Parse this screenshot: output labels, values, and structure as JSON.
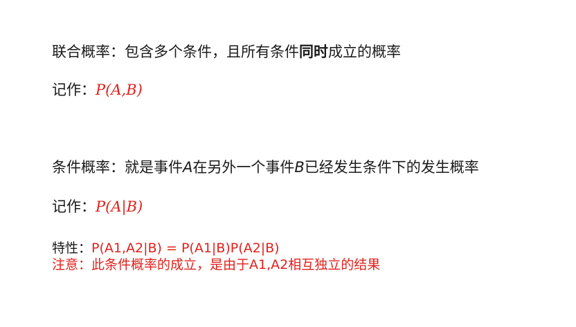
{
  "joint": {
    "title_prefix": "联合概率：包含多个条件，且所有条件",
    "title_emphasis": "同时",
    "title_suffix": "成立的概率",
    "notation_label": "记作：",
    "notation_formula": "P(A,B)"
  },
  "conditional": {
    "title_prefix": "条件概率：就是事件",
    "event_a": "A",
    "title_middle": "在另外一个事件",
    "event_b": "B",
    "title_suffix": "已经发生条件下的发生概率",
    "notation_label": "记作：",
    "notation_formula": "P(A|B)"
  },
  "property": {
    "label": "特性：",
    "formula": "P(A1,A2|B) = P(A1|B)P(A2|B)"
  },
  "note": {
    "text": "注意：此条件概率的成立，是由于A1,A2相互独立的结果"
  },
  "colors": {
    "text": "#1a1a1a",
    "accent_red": "#e0201b"
  }
}
